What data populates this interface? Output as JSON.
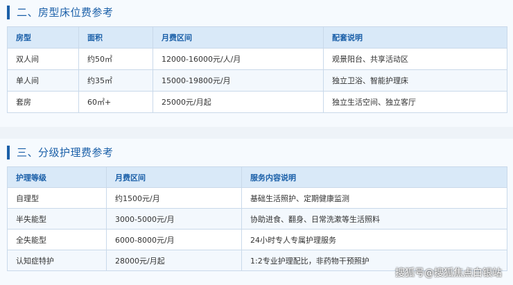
{
  "section1": {
    "title": "二、房型床位费参考",
    "headers": [
      "房型",
      "面积",
      "月费区间",
      "配套说明"
    ],
    "rows": [
      [
        "双人间",
        "约50㎡",
        "12000-16000元/人/月",
        "观景阳台、共享活动区"
      ],
      [
        "单人间",
        "约35㎡",
        "15000-19800元/月",
        "独立卫浴、智能护理床"
      ],
      [
        "套房",
        "60㎡+",
        "25000元/月起",
        "独立生活空间、独立客厅"
      ]
    ]
  },
  "section2": {
    "title": "三、分级护理费参考",
    "headers": [
      "护理等级",
      "月费区间",
      "服务内容说明"
    ],
    "rows": [
      [
        "自理型",
        "约1500元/月",
        "基础生活照护、定期健康监测"
      ],
      [
        "半失能型",
        "3000-5000元/月",
        "协助进食、翻身、日常洗漱等生活照料"
      ],
      [
        "全失能型",
        "6000-8000元/月",
        "24小时专人专属护理服务"
      ],
      [
        "认知症特护",
        "28000元/月起",
        "1:2专业护理配比，非药物干预照护"
      ]
    ]
  },
  "watermark": "搜狐号@搜狐焦点白银站",
  "colors": {
    "accent": "#1a5fa8",
    "header_bg": "#d9e9f8",
    "border": "#c9d9ea"
  }
}
